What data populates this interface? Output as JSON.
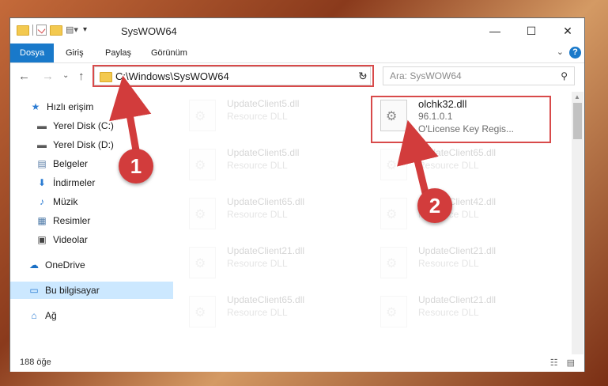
{
  "window": {
    "title": "SysWOW64",
    "minimize": "—",
    "maximize": "☐",
    "close": "✕"
  },
  "ribbon": {
    "tabs": [
      "Dosya",
      "Giriş",
      "Paylaş",
      "Görünüm"
    ],
    "help": "?"
  },
  "nav": {
    "back": "←",
    "forward": "→",
    "recent": "⌄",
    "up": "↑",
    "address": "C:\\Windows\\SysWOW64",
    "refresh": "↻",
    "search_placeholder": "Ara: SysWOW64",
    "search_icon": "⚲"
  },
  "sidebar": {
    "items": [
      {
        "label": "Hızlı erişim",
        "icon": "★",
        "pinned": false
      },
      {
        "label": "Yerel Disk (C:)",
        "icon": "▬",
        "pinned": true
      },
      {
        "label": "Yerel Disk (D:)",
        "icon": "▬",
        "pinned": true
      },
      {
        "label": "Belgeler",
        "icon": "▤",
        "pinned": true
      },
      {
        "label": "İndirmeler",
        "icon": "⬇",
        "pinned": true
      },
      {
        "label": "Müzik",
        "icon": "♪",
        "pinned": true
      },
      {
        "label": "Resimler",
        "icon": "▦",
        "pinned": true
      },
      {
        "label": "Videolar",
        "icon": "▣",
        "pinned": true
      },
      {
        "label": "OneDrive",
        "icon": "☁",
        "pinned": false
      },
      {
        "label": "Bu bilgisayar",
        "icon": "▭",
        "pinned": false
      },
      {
        "label": "Ağ",
        "icon": "⌂",
        "pinned": false
      }
    ],
    "pin_glyph": "✦"
  },
  "files": {
    "faded": [
      {
        "name": "UpdateClient5.dll",
        "type": "Resource DLL"
      },
      {
        "name": "UpdateClient5.dll",
        "type": "Resource DLL"
      },
      {
        "name": "UpdateClient65.dll",
        "type": "Resource DLL"
      },
      {
        "name": "UpdateClient21.dll",
        "type": "Resource DLL"
      },
      {
        "name": "UpdateClient65.dll",
        "type": "Resource DLL"
      },
      {
        "name": "UpdateClient65.dll",
        "type": "Resource DLL"
      },
      {
        "name": "UpdateClient42.dll",
        "type": "Resource DLL"
      },
      {
        "name": "UpdateClient21.dll",
        "type": "Resource DLL"
      },
      {
        "name": "UpdateClient21.dll",
        "type": "Resource DLL"
      }
    ],
    "highlighted": {
      "name": "olchk32.dll",
      "version": "96.1.0.1",
      "description": "O'License Key Regis..."
    }
  },
  "status": {
    "count": "188 öğe",
    "view_icons": "☷ ▤"
  },
  "annotations": {
    "badge1": "1",
    "badge2": "2"
  },
  "colors": {
    "accent": "#1979ca",
    "highlight_red": "#d84a4a",
    "badge_red": "#d23c3c",
    "selected_bg": "#cce8ff"
  }
}
